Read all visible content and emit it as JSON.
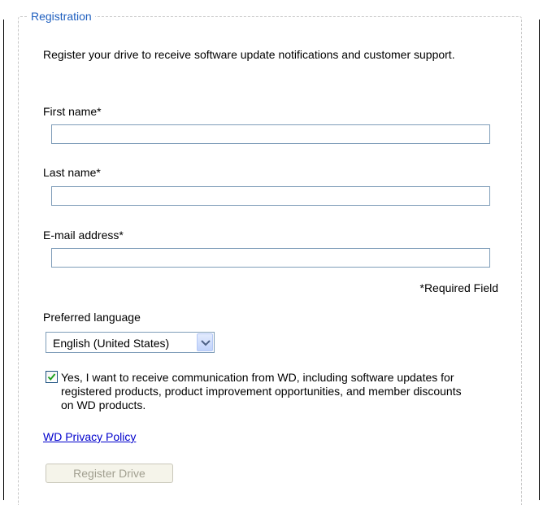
{
  "registration": {
    "legend": "Registration",
    "intro": "Register your drive to receive software update notifications and customer support.",
    "fields": {
      "first_name": {
        "label": "First name*",
        "value": ""
      },
      "last_name": {
        "label": "Last name*",
        "value": ""
      },
      "email": {
        "label": "E-mail address*",
        "value": ""
      }
    },
    "required_note": "*Required Field",
    "language": {
      "label": "Preferred language",
      "selected": "English (United States)"
    },
    "consent": {
      "checked": true,
      "text": "Yes, I want to receive communication from WD, including software updates for registered products, product improvement opportunities, and member discounts on WD products."
    },
    "privacy_link": "WD Privacy Policy",
    "register_button": {
      "label": "Register Drive",
      "enabled": false
    }
  },
  "icons": {
    "dropdown": "chevron-down-icon",
    "checkbox": "checkmark-icon"
  },
  "colors": {
    "legend": "#1f5fbf",
    "link": "#0000cc",
    "input_border": "#7f9db9",
    "disabled_text": "#a19f90",
    "check_green": "#21a121"
  }
}
